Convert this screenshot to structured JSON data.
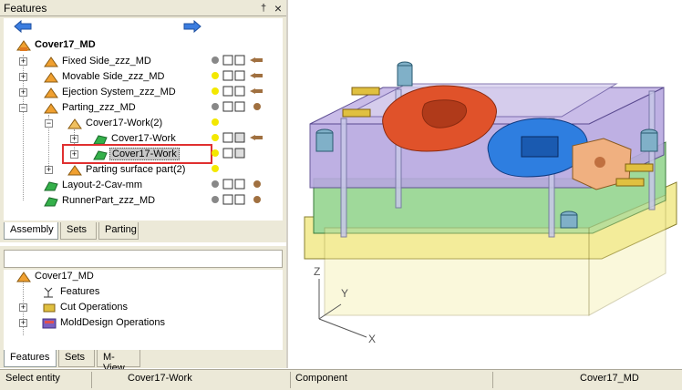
{
  "features_panel": {
    "title": "Features",
    "pin": "†",
    "close": "×",
    "tree": {
      "root": "Cover17_MD",
      "items": [
        {
          "label": "Fixed Side_zzz_MD"
        },
        {
          "label": "Movable Side_zzz_MD"
        },
        {
          "label": "Ejection System_zzz_MD"
        },
        {
          "label": "Parting_zzz_MD"
        },
        {
          "label": "Cover17-Work(2)"
        },
        {
          "label": "Cover17-Work"
        },
        {
          "label": "Cover17-Work"
        },
        {
          "label": "Parting surface part(2)"
        },
        {
          "label": "Layout-2-Cav-mm"
        },
        {
          "label": "RunnerPart_zzz_MD"
        }
      ]
    },
    "tabs": [
      "Assembly",
      "Sets",
      "Parting"
    ]
  },
  "lower_panel": {
    "tree": {
      "root": "Cover17_MD",
      "items": [
        {
          "label": "Features"
        },
        {
          "label": "Cut Operations"
        },
        {
          "label": "MoldDesign Operations"
        }
      ]
    },
    "tabs": [
      "Features",
      "Sets",
      "M-View"
    ]
  },
  "viewport": {
    "axis_labels": {
      "x": "X",
      "y": "Y",
      "z": "Z"
    }
  },
  "status_bar": {
    "prompt": "Select entity",
    "entity": "Cover17-Work",
    "type": "Component",
    "document": "Cover17_MD"
  },
  "colors": {
    "selection_outline": "#e03030",
    "mold_green": "#9fd99a",
    "mold_purple": "#b8a8e0",
    "mold_yellow": "#f3ec9a",
    "cavity_orange": "#e0522a",
    "cavity_blue": "#2e7ee0"
  }
}
